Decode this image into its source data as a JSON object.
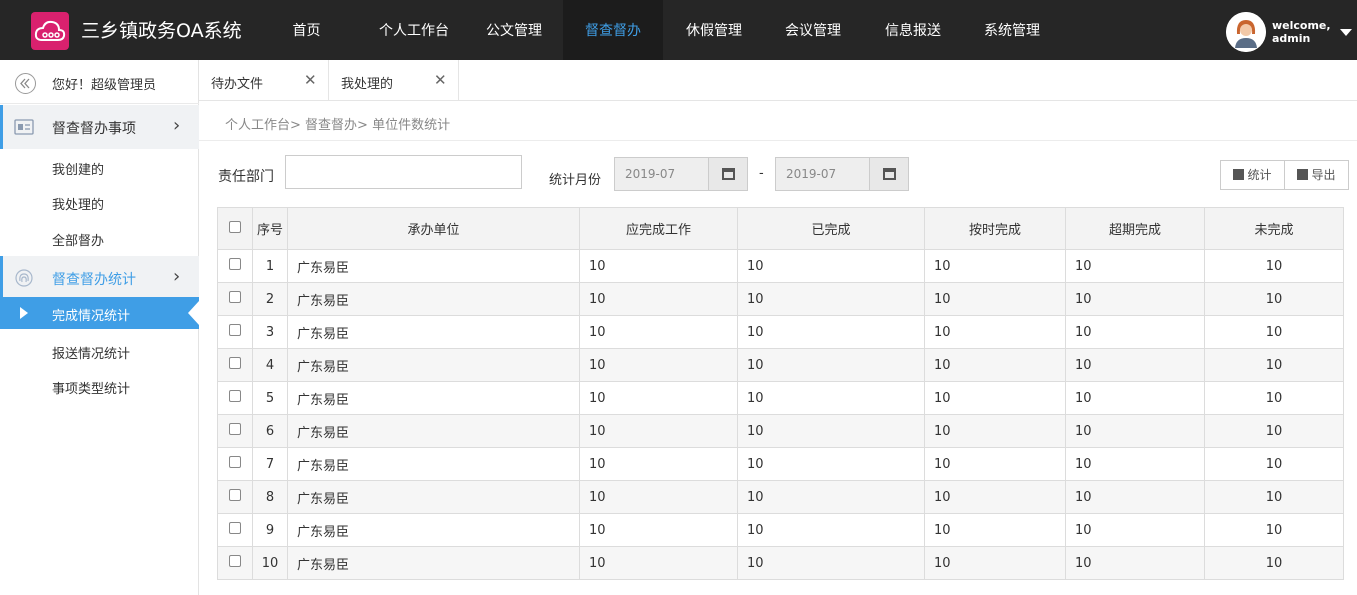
{
  "header": {
    "app_title": "三乡镇政务OA系统",
    "nav": [
      "首页",
      "个人工作台",
      "公文管理",
      "督查督办",
      "休假管理",
      "会议管理",
      "信息报送",
      "系统管理"
    ],
    "active_nav": "督查督办",
    "welcome": "welcome,",
    "username": "admin"
  },
  "sidebar": {
    "greeting": "您好！超级管理员",
    "groups": [
      {
        "label": "督查督办事项",
        "items": [
          "我创建的",
          "我处理的",
          "全部督办"
        ]
      },
      {
        "label": "督查督办统计",
        "items": [
          "完成情况统计",
          "报送情况统计",
          "事项类型统计"
        ]
      }
    ],
    "active_item": "完成情况统计"
  },
  "tabs": [
    {
      "label": "待办文件"
    },
    {
      "label": "我处理的"
    }
  ],
  "breadcrumb": [
    "个人工作台>",
    "督查督办>",
    "单位件数统计"
  ],
  "filters": {
    "dept_label": "责任部门",
    "dept_value": "",
    "month_label": "统计月份",
    "date_from": "2019-07",
    "date_separator": "-",
    "date_to": "2019-07",
    "stat_button": "统计",
    "export_button": "导出"
  },
  "table": {
    "columns": [
      "序号",
      "承办单位",
      "应完成工作",
      "已完成",
      "按时完成",
      "超期完成",
      "未完成"
    ],
    "rows": [
      [
        "1",
        "广东易臣",
        "10",
        "10",
        "10",
        "10",
        "10"
      ],
      [
        "2",
        "广东易臣",
        "10",
        "10",
        "10",
        "10",
        "10"
      ],
      [
        "3",
        "广东易臣",
        "10",
        "10",
        "10",
        "10",
        "10"
      ],
      [
        "4",
        "广东易臣",
        "10",
        "10",
        "10",
        "10",
        "10"
      ],
      [
        "5",
        "广东易臣",
        "10",
        "10",
        "10",
        "10",
        "10"
      ],
      [
        "6",
        "广东易臣",
        "10",
        "10",
        "10",
        "10",
        "10"
      ],
      [
        "7",
        "广东易臣",
        "10",
        "10",
        "10",
        "10",
        "10"
      ],
      [
        "8",
        "广东易臣",
        "10",
        "10",
        "10",
        "10",
        "10"
      ],
      [
        "9",
        "广东易臣",
        "10",
        "10",
        "10",
        "10",
        "10"
      ],
      [
        "10",
        "广东易臣",
        "10",
        "10",
        "10",
        "10",
        "10"
      ]
    ]
  },
  "colors": {
    "accent": "#3f9ee6",
    "topbar": "#262626",
    "brand": "#d9216e"
  }
}
